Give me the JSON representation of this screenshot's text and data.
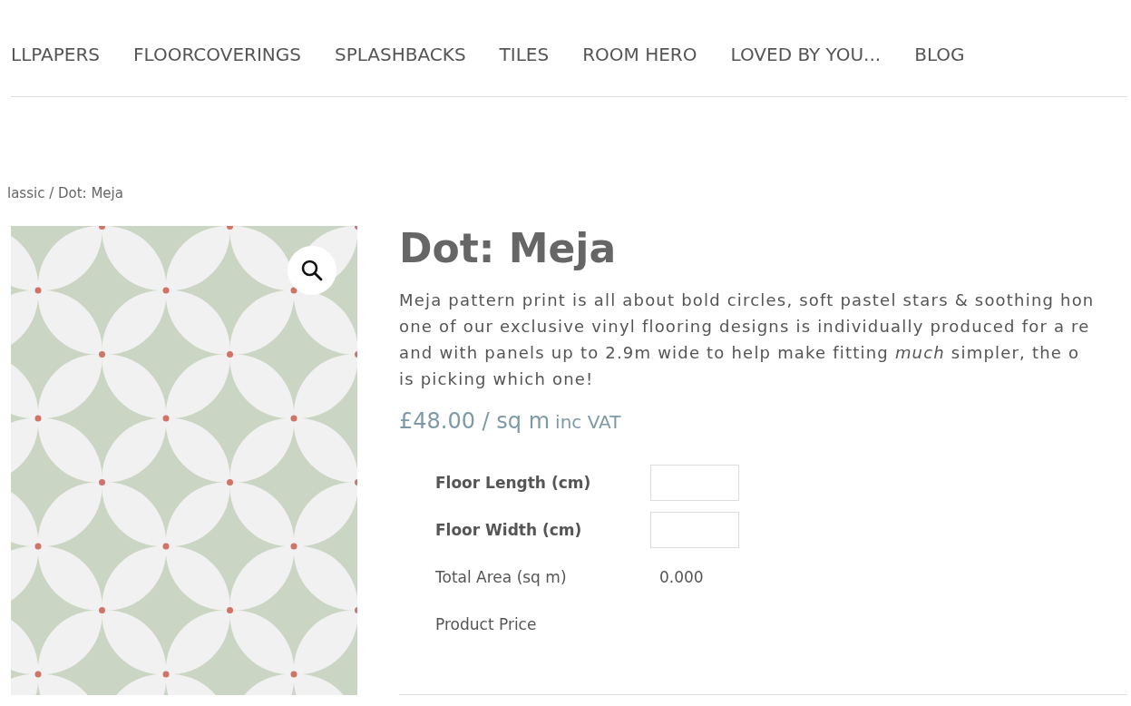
{
  "nav": {
    "items": [
      "LLPAPERS",
      "FLOORCOVERINGS",
      "SPLASHBACKS",
      "TILES",
      "ROOM HERO",
      "LOVED BY YOU...",
      "BLOG"
    ]
  },
  "breadcrumb": "lassic / Dot: Meja",
  "product": {
    "title": "Dot: Meja",
    "description_lines": [
      "Meja pattern print is all about bold circles, soft pastel stars & soothing hon",
      "one of our exclusive vinyl flooring designs is individually produced for a re",
      "and with panels up to 2.9m wide to help make fitting *much* simpler, the o",
      "is picking which one!"
    ],
    "price": "£48.00 / sq m",
    "price_suffix": "inc VAT"
  },
  "calculator": [
    {
      "kind": "input",
      "label": "Floor Length (cm)"
    },
    {
      "kind": "input",
      "label": "Floor Width (cm)"
    },
    {
      "kind": "value",
      "label": "Total Area (sq m)",
      "value": "0.000"
    },
    {
      "kind": "text",
      "label": "Product Price"
    }
  ]
}
